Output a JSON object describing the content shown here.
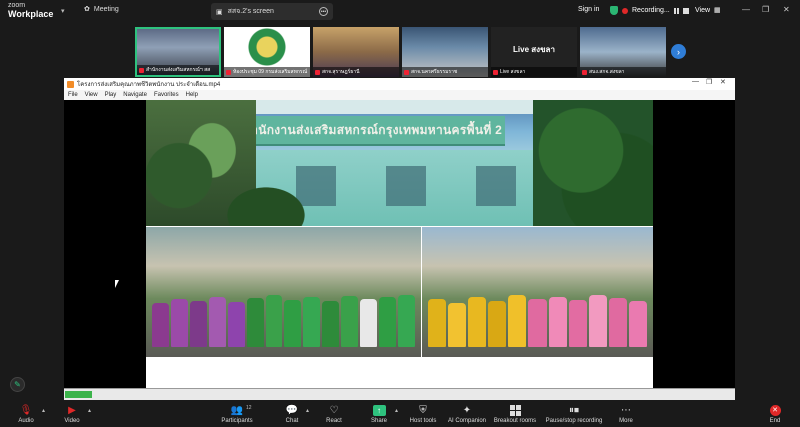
{
  "app": {
    "brand_line1": "zoom",
    "brand_line2": "Workplace",
    "meeting_label": "Meeting",
    "share_tab_label": "สสจ.2's screen",
    "signin_label": "Sign in",
    "recording_label": "Recording...",
    "view_label": "View",
    "accent_color": "#2ec27e",
    "record_color": "#e02828"
  },
  "participants": [
    {
      "name": "สำนักงานส่งเสริมสหกรณ์ฯ สส",
      "active": true
    },
    {
      "name": "ห้องประชุม 09 กรมส่งเสริมสหกรณ์",
      "active": false
    },
    {
      "name": "สกจ.สุราษฎร์ธานี",
      "active": false
    },
    {
      "name": "สกจ.นครศรีธรรมราช",
      "active": false
    },
    {
      "name": "Live สงขลา",
      "active": false,
      "tile_text": "Live สงขลา"
    },
    {
      "name": "สนง.สกจ.สงขลา",
      "active": false
    }
  ],
  "player": {
    "title": "โครงการส่งเสริมคุณภาพชีวิตพนักงาน ประจำเดือน.mp4",
    "menu": [
      "File",
      "View",
      "Play",
      "Navigate",
      "Favorites",
      "Help"
    ],
    "progress_fraction": 0.04,
    "sign_text": "สำนักงานส่งเสริมสหกรณ์กรุงเทพมหานครพื้นที่ 2"
  },
  "toolbar": {
    "audio": "Audio",
    "video": "Video",
    "participants": "Participants",
    "participants_count": "12",
    "chat": "Chat",
    "react": "React",
    "share": "Share",
    "host_tools": "Host tools",
    "ai_companion": "AI Companion",
    "breakout_rooms": "Breakout rooms",
    "pause_stop_recording": "Pause/stop recording",
    "more": "More",
    "end": "End"
  }
}
